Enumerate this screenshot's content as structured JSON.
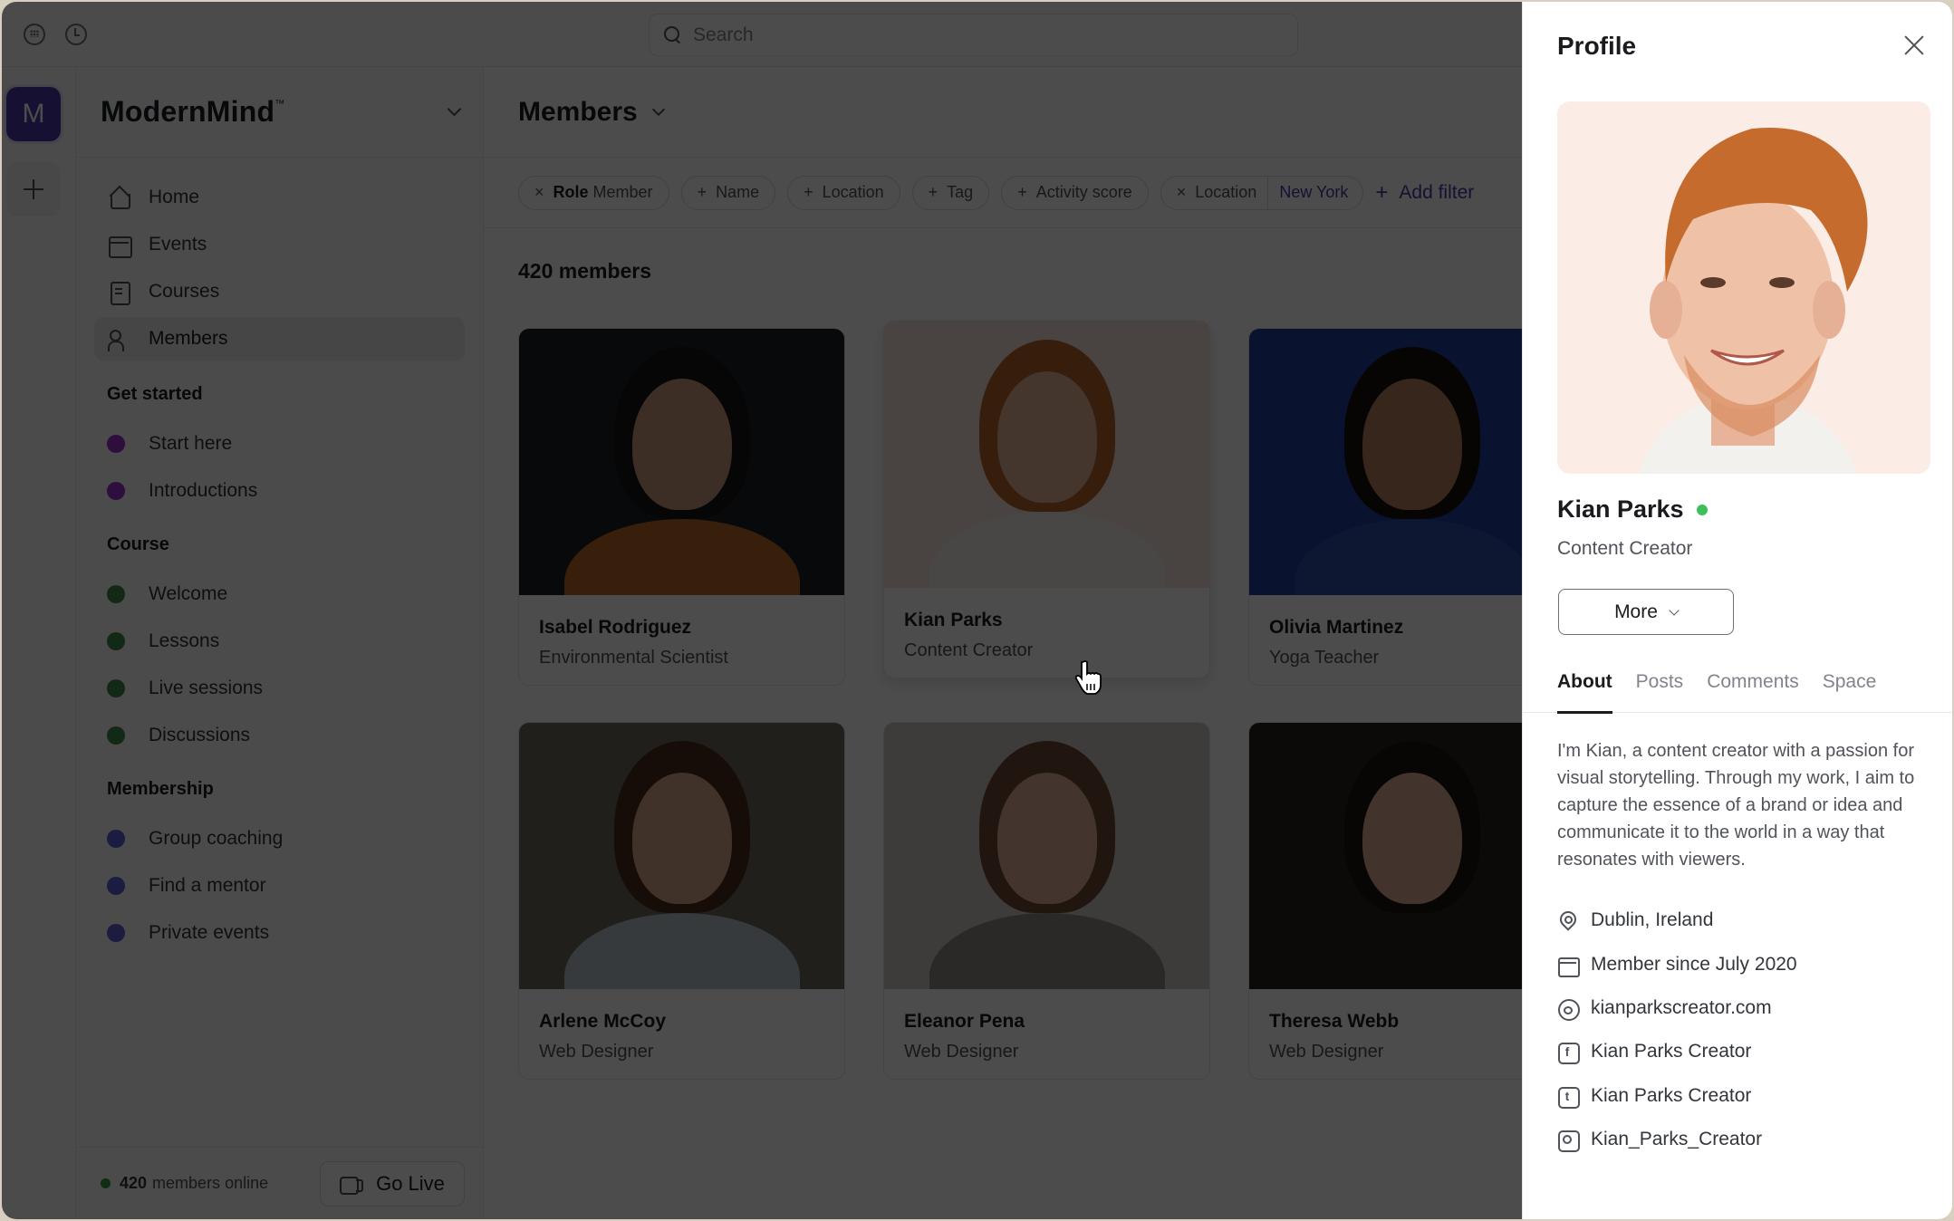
{
  "topbar": {
    "search_placeholder": "Search"
  },
  "rail": {
    "workspace_initial": "M"
  },
  "sidebar": {
    "brand": "ModernMind",
    "brand_mark": "™",
    "nav": [
      {
        "label": "Home",
        "icon": "home-icon"
      },
      {
        "label": "Events",
        "icon": "calendar-icon"
      },
      {
        "label": "Courses",
        "icon": "course-icon"
      },
      {
        "label": "Members",
        "icon": "members-icon",
        "active": true
      }
    ],
    "sections": [
      {
        "title": "Get started",
        "color": "#9b2fc9",
        "items": [
          "Start here",
          "Introductions"
        ]
      },
      {
        "title": "Course",
        "color": "#3f8a4a",
        "items": [
          "Welcome",
          "Lessons",
          "Live sessions",
          "Discussions"
        ]
      },
      {
        "title": "Membership",
        "color": "#5a5fd8",
        "items": [
          "Group coaching",
          "Find a mentor",
          "Private events"
        ]
      }
    ],
    "footer": {
      "online_count": "420",
      "online_label": "members online",
      "go_live_label": "Go Live"
    }
  },
  "main": {
    "title": "Members",
    "filters": [
      {
        "kind": "active",
        "symbol": "×",
        "key": "Role",
        "value": "Member"
      },
      {
        "kind": "add",
        "symbol": "+",
        "label": "Name"
      },
      {
        "kind": "add",
        "symbol": "+",
        "label": "Location"
      },
      {
        "kind": "add",
        "symbol": "+",
        "label": "Tag"
      },
      {
        "kind": "add",
        "symbol": "+",
        "label": "Activity score"
      },
      {
        "kind": "split",
        "symbol": "×",
        "label": "Location",
        "value": "New York"
      }
    ],
    "add_filter_label": "Add filter",
    "member_count": "420 members",
    "members": [
      {
        "name": "Isabel Rodriguez",
        "role": "Environmental Scientist"
      },
      {
        "name": "Kian Parks",
        "role": "Content Creator",
        "hovered": true
      },
      {
        "name": "Olivia Martinez",
        "role": "Yoga Teacher"
      },
      {
        "name": "Arlene McCoy",
        "role": "Web Designer"
      },
      {
        "name": "Eleanor Pena",
        "role": "Web Designer"
      },
      {
        "name": "Theresa Webb",
        "role": "Web Designer"
      }
    ]
  },
  "profile": {
    "title": "Profile",
    "name": "Kian Parks",
    "status": "online",
    "role": "Content Creator",
    "more_label": "More",
    "tabs": [
      "About",
      "Posts",
      "Comments",
      "Space"
    ],
    "active_tab": "About",
    "bio": "I'm Kian, a content creator with a passion for visual storytelling. Through my work, I aim to capture the essence of a brand or idea and communicate it to the world in a way that resonates with viewers.",
    "details": [
      {
        "icon": "location-pin-icon",
        "text": "Dublin, Ireland"
      },
      {
        "icon": "calendar-icon",
        "text": "Member since July 2020"
      },
      {
        "icon": "globe-icon",
        "text": "kianparkscreator.com"
      },
      {
        "icon": "facebook-icon",
        "text": "Kian Parks Creator"
      },
      {
        "icon": "twitter-icon",
        "text": "Kian Parks Creator"
      },
      {
        "icon": "instagram-icon",
        "text": "Kian_Parks_Creator"
      }
    ]
  },
  "colors": {
    "accent": "#4a3aa8",
    "online": "#3cc15a"
  }
}
